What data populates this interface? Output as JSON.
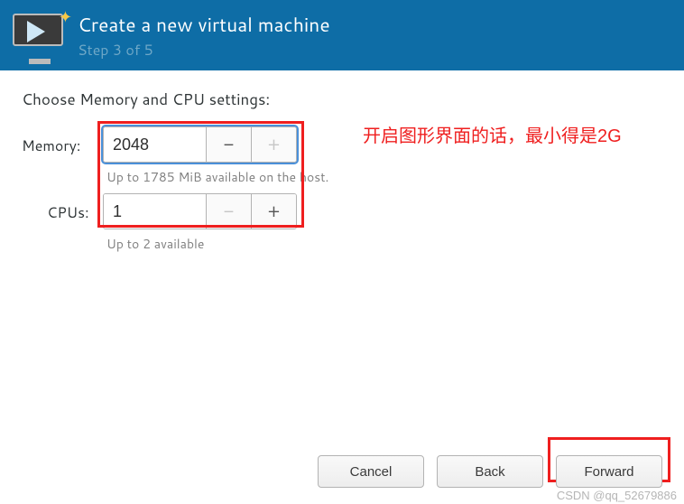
{
  "header": {
    "title": "Create a new virtual machine",
    "subtitle": "Step 3 of 5"
  },
  "section": {
    "heading": "Choose Memory and CPU settings:"
  },
  "memory": {
    "label": "Memory:",
    "value": "2048",
    "hint": "Up to 1785 MiB available on the host.",
    "minus": "−",
    "plus": "+"
  },
  "cpus": {
    "label": "CPUs:",
    "value": "1",
    "hint": "Up to 2 available",
    "minus": "−",
    "plus": "+"
  },
  "footer": {
    "cancel": "Cancel",
    "back": "Back",
    "forward": "Forward"
  },
  "annotation": {
    "text": "开启图形界面的话，最小得是2G"
  },
  "watermark": "CSDN @qq_52679886"
}
